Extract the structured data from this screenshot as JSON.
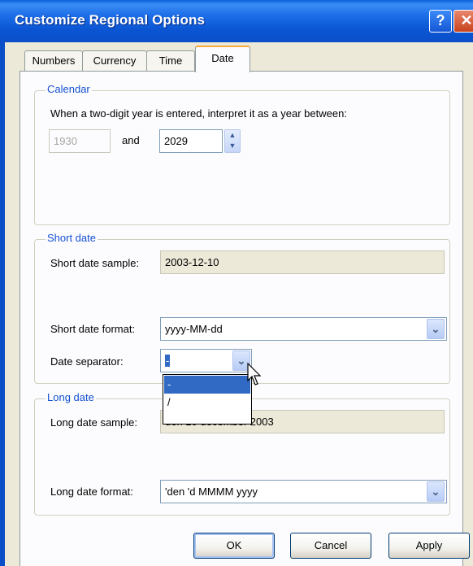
{
  "window": {
    "title": "Customize Regional Options",
    "help_icon": "question-icon",
    "close_icon": "close-icon"
  },
  "tabs": [
    {
      "label": "Numbers",
      "active": false
    },
    {
      "label": "Currency",
      "active": false
    },
    {
      "label": "Time",
      "active": false
    },
    {
      "label": "Date",
      "active": true
    }
  ],
  "calendar": {
    "legend": "Calendar",
    "description": "When a two-digit year is entered, interpret it as a year between:",
    "from_year": "1930",
    "and_label": "and",
    "to_year": "2029"
  },
  "short_date": {
    "legend": "Short date",
    "sample_label": "Short date sample:",
    "sample_value": "2003-12-10",
    "format_label": "Short date format:",
    "format_value": "yyyy-MM-dd",
    "separator_label": "Date separator:",
    "separator_value": "-",
    "separator_options": [
      "-",
      "/"
    ],
    "separator_selected_index": 0
  },
  "long_date": {
    "legend": "Long date",
    "sample_label": "Long date sample:",
    "sample_value": "den 10 december 2003",
    "format_label": "Long date format:",
    "format_value": "'den 'd MMMM yyyy"
  },
  "buttons": {
    "ok": "OK",
    "cancel": "Cancel",
    "apply": "Apply"
  },
  "colors": {
    "titlebar": "#0a55d3",
    "legend_text": "#1550d0",
    "selection": "#316ac5",
    "dialog_bg": "#ece9d8"
  }
}
